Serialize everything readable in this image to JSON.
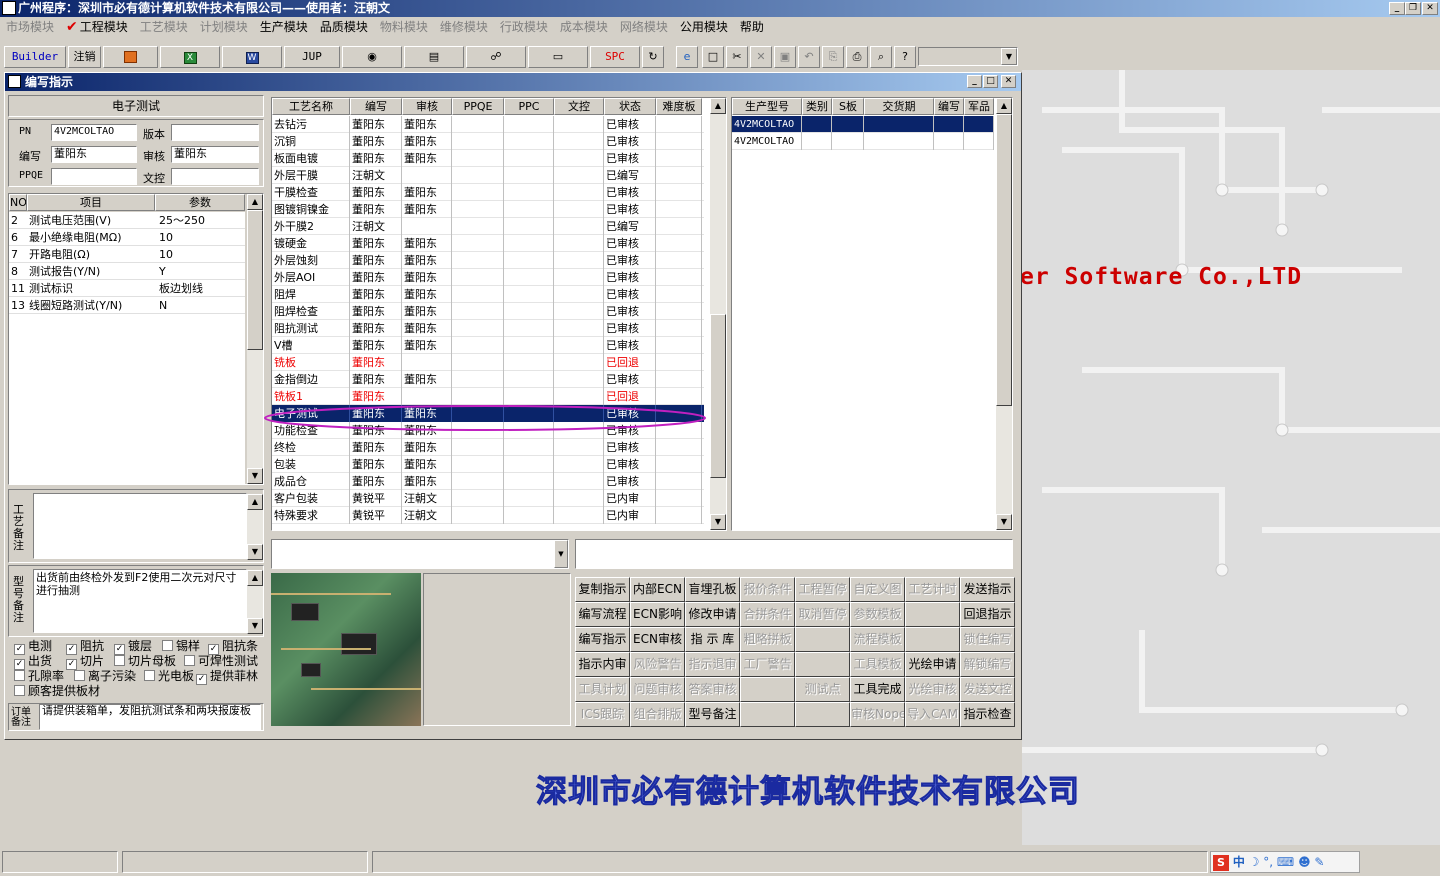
{
  "app": {
    "title": "广州程序：深圳市必有德计算机软件技术有限公司——使用者：汪朝文"
  },
  "menu": [
    {
      "label": "市场模块",
      "enabled": false
    },
    {
      "label": "工程模块",
      "enabled": true,
      "checked": true
    },
    {
      "label": "工艺模块",
      "enabled": false
    },
    {
      "label": "计划模块",
      "enabled": false
    },
    {
      "label": "生产模块",
      "enabled": true
    },
    {
      "label": "品质模块",
      "enabled": true
    },
    {
      "label": "物料模块",
      "enabled": false
    },
    {
      "label": "维修模块",
      "enabled": false
    },
    {
      "label": "行政模块",
      "enabled": false
    },
    {
      "label": "成本模块",
      "enabled": false
    },
    {
      "label": "网络模块",
      "enabled": false
    },
    {
      "label": "公用模块",
      "enabled": true
    },
    {
      "label": "帮助",
      "enabled": true
    }
  ],
  "toolbar": {
    "builder": "Builder",
    "logout": "注销",
    "jup": "JUP",
    "spc": "SPC"
  },
  "window": {
    "title": "编写指示"
  },
  "left": {
    "section_title": "电子测试",
    "pn_label": "PN",
    "pn_value": "4V2MCOLTAO",
    "version_label": "版本",
    "version_value": "",
    "writer_label": "编写",
    "writer_value": "董阳东",
    "review_label": "审核",
    "review_value": "董阳东",
    "ppqe_label": "PPQE",
    "ppqe_value": "",
    "wenkong_label": "文控",
    "wenkong_value": "",
    "param_headers": [
      "NO",
      "项目",
      "参数"
    ],
    "params": [
      {
        "no": "2",
        "item": "测试电压范围(V)",
        "value": "25～250"
      },
      {
        "no": "6",
        "item": "最小绝缘电阻(MΩ)",
        "value": "10"
      },
      {
        "no": "7",
        "item": "开路电阻(Ω)",
        "value": "10"
      },
      {
        "no": "8",
        "item": "测试报告(Y/N)",
        "value": "Y"
      },
      {
        "no": "11",
        "item": "测试标识",
        "value": "板边划线"
      },
      {
        "no": "13",
        "item": "线圈短路测试(Y/N)",
        "value": "N"
      }
    ],
    "process_note_label": "工艺备注",
    "process_note": "",
    "model_note_label": "型号备注",
    "model_note": "出货前由终检外发到F2使用二次元对尺寸进行抽测",
    "checkboxes": [
      {
        "label": "电测",
        "checked": true
      },
      {
        "label": "阻抗",
        "checked": true
      },
      {
        "label": "镀层",
        "checked": true
      },
      {
        "label": "锡样",
        "checked": false
      },
      {
        "label": "阻抗条",
        "checked": true
      },
      {
        "label": "出货",
        "checked": true
      },
      {
        "label": "切片",
        "checked": true
      },
      {
        "label": "切片母板",
        "checked": false
      },
      {
        "label": "可焊性测试",
        "checked": false
      },
      {
        "label": "孔隙率",
        "checked": false
      },
      {
        "label": "离子污染",
        "checked": false
      },
      {
        "label": "光电板",
        "checked": false
      },
      {
        "label": "提供菲林",
        "checked": true
      },
      {
        "label": "顾客提供板材",
        "checked": false
      }
    ],
    "order_note_label": "订单备注",
    "order_note": "请提供装箱单，发阻抗测试条和两块报废板"
  },
  "process_table": {
    "headers": [
      "工艺名称",
      "编写",
      "审核",
      "PPQE",
      "PPC",
      "文控",
      "状态",
      "难度板"
    ],
    "rows": [
      {
        "name": "去钻污",
        "writer": "董阳东",
        "reviewer": "董阳东",
        "status": "已审核"
      },
      {
        "name": "沉铜",
        "writer": "董阳东",
        "reviewer": "董阳东",
        "status": "已审核"
      },
      {
        "name": "板面电镀",
        "writer": "董阳东",
        "reviewer": "董阳东",
        "status": "已审核"
      },
      {
        "name": "外层干膜",
        "writer": "汪朝文",
        "reviewer": "",
        "status": "已编写"
      },
      {
        "name": "干膜检查",
        "writer": "董阳东",
        "reviewer": "董阳东",
        "status": "已审核"
      },
      {
        "name": "图镀铜镍金",
        "writer": "董阳东",
        "reviewer": "董阳东",
        "status": "已审核"
      },
      {
        "name": "外干膜2",
        "writer": "汪朝文",
        "reviewer": "",
        "status": "已编写"
      },
      {
        "name": "镀硬金",
        "writer": "董阳东",
        "reviewer": "董阳东",
        "status": "已审核"
      },
      {
        "name": "外层蚀刻",
        "writer": "董阳东",
        "reviewer": "董阳东",
        "status": "已审核"
      },
      {
        "name": "外层AOI",
        "writer": "董阳东",
        "reviewer": "董阳东",
        "status": "已审核"
      },
      {
        "name": "阻焊",
        "writer": "董阳东",
        "reviewer": "董阳东",
        "status": "已审核"
      },
      {
        "name": "阻焊检查",
        "writer": "董阳东",
        "reviewer": "董阳东",
        "status": "已审核"
      },
      {
        "name": "阻抗测试",
        "writer": "董阳东",
        "reviewer": "董阳东",
        "status": "已审核"
      },
      {
        "name": "V槽",
        "writer": "董阳东",
        "reviewer": "董阳东",
        "status": "已审核"
      },
      {
        "name": "铣板",
        "writer": "董阳东",
        "reviewer": "",
        "status": "已回退",
        "red": true
      },
      {
        "name": "金指倒边",
        "writer": "董阳东",
        "reviewer": "董阳东",
        "status": "已审核"
      },
      {
        "name": "铣板1",
        "writer": "董阳东",
        "reviewer": "",
        "status": "已回退",
        "red": true
      },
      {
        "name": "电子测试",
        "writer": "董阳东",
        "reviewer": "董阳东",
        "status": "已审核",
        "selected": true
      },
      {
        "name": "功能检查",
        "writer": "董阳东",
        "reviewer": "董阳东",
        "status": "已审核"
      },
      {
        "name": "终检",
        "writer": "董阳东",
        "reviewer": "董阳东",
        "status": "已审核"
      },
      {
        "name": "包装",
        "writer": "董阳东",
        "reviewer": "董阳东",
        "status": "已审核"
      },
      {
        "name": "成品仓",
        "writer": "董阳东",
        "reviewer": "董阳东",
        "status": "已审核"
      },
      {
        "name": "客户包装",
        "writer": "黄锐平",
        "reviewer": "汪朝文",
        "status": "已内审"
      },
      {
        "name": "特殊要求",
        "writer": "黄锐平",
        "reviewer": "汪朝文",
        "status": "已内审"
      }
    ]
  },
  "model_table": {
    "headers": [
      "生产型号",
      "类别",
      "S板",
      "交货期",
      "编写",
      "军品"
    ],
    "rows": [
      {
        "model": "4V2MCOLTAO",
        "selected": true
      },
      {
        "model": "4V2MCOLTAO",
        "selected": false
      }
    ]
  },
  "commands": [
    [
      "复制指示",
      "内部ECN",
      "盲埋孔板",
      "报价条件",
      "工程暂停",
      "自定义图",
      "工艺计时",
      "发送指示"
    ],
    [
      "编写流程",
      "ECN影响",
      "修改申请",
      "合拼条件",
      "取消暂停",
      "参数模板",
      "",
      "回退指示"
    ],
    [
      "编写指示",
      "ECN审核",
      "指 示 库",
      "粗略拼板",
      "",
      "流程模板",
      "",
      "锁住编写"
    ],
    [
      "指示内审",
      "风险警告",
      "指示退审",
      "工厂警告",
      "",
      "工具模板",
      "光绘申请",
      "解锁编写"
    ],
    [
      "工具计划",
      "问题审核",
      "答案审核",
      "",
      "测试点",
      "工具完成",
      "光绘审核",
      "发送文控"
    ],
    [
      "ICS跟踪",
      "组合排版",
      "型号备注",
      "",
      "",
      "审核Nope",
      "导入CAM",
      "指示检查"
    ]
  ],
  "commands_enabled": [
    [
      true,
      true,
      true,
      false,
      false,
      false,
      false,
      true
    ],
    [
      true,
      true,
      true,
      false,
      false,
      false,
      false,
      true
    ],
    [
      true,
      true,
      true,
      false,
      false,
      false,
      false,
      false
    ],
    [
      true,
      false,
      false,
      false,
      false,
      false,
      true,
      false
    ],
    [
      false,
      false,
      false,
      false,
      false,
      true,
      false,
      false
    ],
    [
      false,
      false,
      true,
      false,
      false,
      false,
      false,
      true
    ]
  ],
  "background": {
    "watermark_en": "er Software Co.,LTD",
    "watermark_cn": "深圳市必有德计算机软件技术有限公司"
  },
  "ime": {
    "label": "中"
  }
}
